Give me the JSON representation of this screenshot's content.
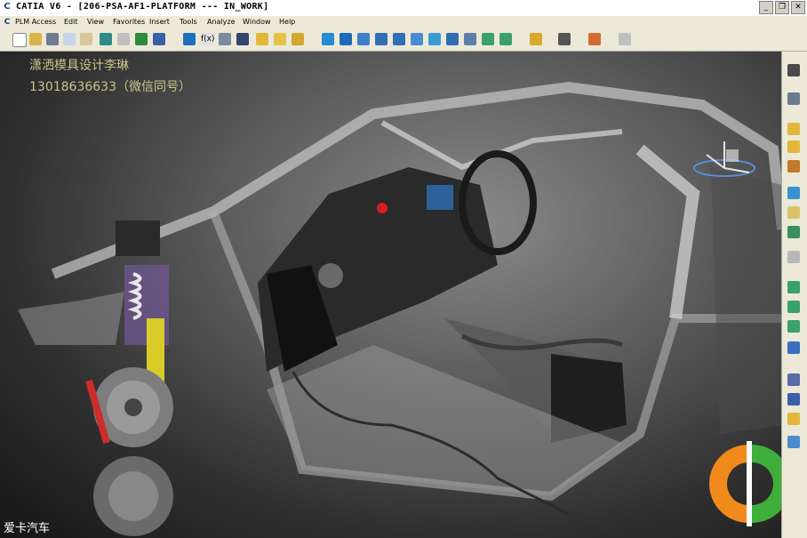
{
  "window": {
    "title": "CATIA V6 - [206-PSA-AF1-PLATFORM --- IN_WORK]",
    "icon": "catia-app-icon",
    "controls": [
      "minimize",
      "restore",
      "close"
    ]
  },
  "menu": {
    "items": [
      "PLM Access",
      "Edit",
      "View",
      "Favorites",
      "Insert",
      "Tools",
      "Analyze",
      "Window",
      "Help"
    ]
  },
  "viewport": {
    "overlay_line1": "潇洒模具设计李琳",
    "overlay_line2": "13018636633（微信同号）",
    "watermark": "爱卡汽车",
    "content": "3D car platform cutaway model"
  },
  "colors": {
    "overlay_text": "#c8c48a",
    "toolbar_bg": "#ece9d8",
    "logo_orange": "#f08a1c",
    "logo_green": "#3fae3a"
  }
}
